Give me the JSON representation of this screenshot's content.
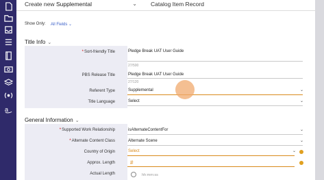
{
  "sidebar": {
    "icons": [
      "document-icon",
      "folder-icon",
      "inbox-icon",
      "list-icon",
      "book-icon",
      "video-icon",
      "layers-icon",
      "broadcast-icon",
      "amazon-icon"
    ]
  },
  "header": {
    "create_label": "Create new",
    "type_value": "Supplemental",
    "record_label": "Catalog Item Record"
  },
  "filter": {
    "label": "Show Only:",
    "value": "All Fields"
  },
  "title_info": {
    "heading": "Title Info",
    "fields": {
      "sort_title": {
        "label": "Sort-friendly Title",
        "value": "Pledge Break UAT User Guide",
        "counter": "27/500"
      },
      "pbs_title": {
        "label": "PBS Release Title",
        "value": "Pledge Break UAT User Guide",
        "counter": "27/120"
      },
      "referent_type": {
        "label": "Referent Type",
        "value": "Supplemental"
      },
      "title_language": {
        "label": "Title Language",
        "value": "Select"
      }
    }
  },
  "general_info": {
    "heading": "General Information",
    "fields": {
      "supported_rel": {
        "label": "Supported Work Relationship",
        "value": "isAlternateContentFor"
      },
      "alt_class": {
        "label": "Alternate Content Class",
        "value": "Alternate Scene"
      },
      "country": {
        "label": "Country of Origin",
        "value": "Select"
      },
      "approx_length": {
        "label": "Approx. Length",
        "value": "#"
      },
      "actual_length": {
        "label": "Actual Length",
        "placeholder": "hh:mm:ss"
      }
    }
  },
  "colors": {
    "sidebar": "#2f2a6a",
    "accent": "#3a5fc8",
    "warning": "#e0a020"
  }
}
